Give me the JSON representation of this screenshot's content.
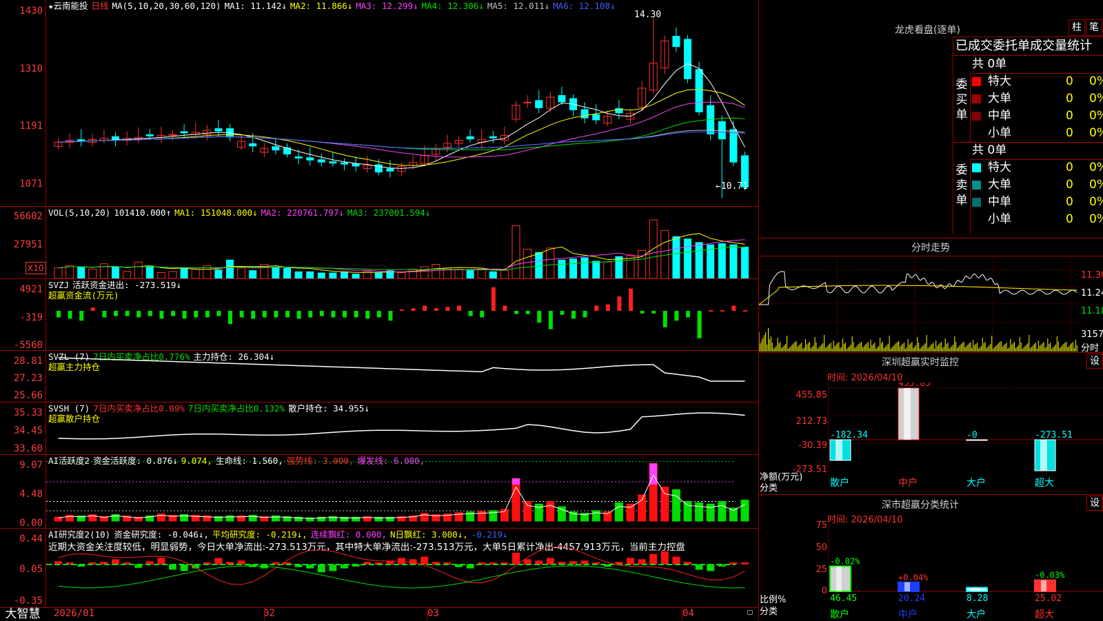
{
  "k": {
    "title": "★云南能投",
    "period": "日线",
    "ma_label": "MA(5,10,20,30,60,120)",
    "ma": [
      {
        "n": "MA1:",
        "v": "11.142↓",
        "c": "#ffffff"
      },
      {
        "n": "MA2:",
        "v": "11.866↓",
        "c": "#ffff00"
      },
      {
        "n": "MA3:",
        "v": "12.299↓",
        "c": "#ff40ff"
      },
      {
        "n": "MA4:",
        "v": "12.306↓",
        "c": "#00e000"
      },
      {
        "n": "MA5:",
        "v": "12.011↓",
        "c": "#c0c0c0"
      },
      {
        "n": "MA6:",
        "v": "12.108↓",
        "c": "#4060ff"
      }
    ],
    "y_ticks": [
      "1430",
      "1310",
      "1191",
      "1071"
    ],
    "high_note": "14.30",
    "low_note": "←10.71"
  },
  "vol": {
    "label": "VOL(5,10,20)",
    "value": "101410.000↑",
    "ma": [
      {
        "n": "MA1:",
        "v": "151048.000↓",
        "c": "#ffff00"
      },
      {
        "n": "MA2:",
        "v": "220761.797↓",
        "c": "#ff40ff"
      },
      {
        "n": "MA3:",
        "v": "237001.594↓",
        "c": "#00e000"
      }
    ],
    "y_ticks": [
      "56602",
      "27951"
    ],
    "unit": "X10"
  },
  "svzj": {
    "label": "SVZJ",
    "text": "活跃资金进出: -273.519↓",
    "sub": "超赢资金流(万元)",
    "y_ticks": [
      "4921",
      "-319",
      "-5560"
    ]
  },
  "svzl": {
    "label": "SVZL (7)",
    "t1": "7日内买卖净占比0.776%",
    "t2": "主力持仓: 26.304↓",
    "sub": "超赢主力持仓",
    "y_ticks": [
      "28.81",
      "27.23",
      "25.66"
    ]
  },
  "svsh": {
    "label": "SVSH (7)",
    "t1": "7日内买卖净占比0.09%",
    "t2": "7日内买卖净占比0.132%",
    "t3": "散户持仓: 34.955↓",
    "sub": "超赢散户持仓",
    "y_ticks": [
      "35.33",
      "34.45",
      "33.60"
    ]
  },
  "ai1": {
    "label": "AI活跃度2",
    "t1": "资金活跃度: 0.876↓",
    "t2": "9.074,",
    "t3": "生命线: 1.560,",
    "t4": "强势线: 3.000,",
    "t5": "爆发线: 6.000,",
    "y_ticks": [
      "9.07",
      "4.48",
      "0.00"
    ]
  },
  "ai2": {
    "label": "AI研究度2(10)",
    "t1": "资金研究度: -0.046↓,",
    "t2": "平均研究度: -0.219↓,",
    "t3": "连续飘红: 0.000,",
    "t4": "N日飘红: 3.000↓,",
    "t5": "-0.219↓",
    "comment": "近期大资金关注度较低，明显弱势，今日大单净流出:-273.513万元，其中特大单净流出:-273.513万元，大单5日累计净出-4457.913万元，当前主力控盘",
    "y_ticks": [
      "0.44",
      "0.05",
      "-0.35"
    ]
  },
  "x_ticks": [
    "2026/01",
    "02",
    "03",
    "04"
  ],
  "brand": "大智慧",
  "longhu": {
    "title": "龙虎看盘(逐单)",
    "btn1": "柱",
    "btn2": "笔",
    "tabs": "已成交委托单成交量统计",
    "buy_label": "委买单",
    "sell_label": "委卖单",
    "buy_total": "共 0单",
    "sell_total": "共 0单",
    "buy_rows": [
      {
        "name": "特大",
        "qty": "0",
        "pct": "0%",
        "color": "#ff0000"
      },
      {
        "name": "大单",
        "qty": "0",
        "pct": "0%",
        "color": "#a00000"
      },
      {
        "name": "中单",
        "qty": "0",
        "pct": "0%",
        "color": "#800000"
      },
      {
        "name": "小单",
        "qty": "0",
        "pct": "0%",
        "color": ""
      }
    ],
    "sell_rows": [
      {
        "name": "特大",
        "qty": "0",
        "pct": "0%",
        "color": "#00ffff"
      },
      {
        "name": "大单",
        "qty": "0",
        "pct": "0%",
        "color": "#009090"
      },
      {
        "name": "中单",
        "qty": "0",
        "pct": "0%",
        "color": "#007070"
      },
      {
        "name": "小单",
        "qty": "0",
        "pct": "0%",
        "color": ""
      }
    ]
  },
  "intraday": {
    "title": "分时走势",
    "y_ticks": [
      "11.30",
      "11.24",
      "11.18"
    ],
    "vol_tick": "3157",
    "vol_unit": "分时"
  },
  "monitor": {
    "title": "深圳超赢实时监控",
    "btn": "设",
    "time": "时间: 2026/04/10",
    "y_ticks": [
      "455.85",
      "212.73",
      "-30.39",
      "-273.51"
    ],
    "y_label": "净额(万元)",
    "x_label": "分类",
    "categories": [
      "散户",
      "中户",
      "大户",
      "超大"
    ],
    "values": [
      "-182.34",
      "455.85",
      "-0",
      "-273.51"
    ]
  },
  "stats": {
    "title": "深市超赢分类统计",
    "btn": "设",
    "time": "时间: 2026/04/10",
    "y_ticks": [
      "75",
      "50",
      "25",
      "0"
    ],
    "y_label": "比例%",
    "x_label": "分类",
    "categories": [
      "散户",
      "中户",
      "大户",
      "超大"
    ],
    "values": [
      "46.45",
      "20.24",
      "8.28",
      "25.02"
    ],
    "changes": [
      "-0.02%",
      "+0.04%",
      "",
      "-0.03%"
    ]
  },
  "chart_data": [
    {
      "type": "candlestick",
      "title": "云南能投 日线",
      "y_ticks": [
        "14.30",
        "13.10",
        "11.91",
        "10.71"
      ],
      "high": "14.30",
      "low": "10.71"
    },
    {
      "type": "bar",
      "title": "VOL(5,10,20)",
      "y_ticks": [
        56602,
        27951
      ],
      "unit": "X10"
    },
    {
      "type": "bar",
      "title": "超赢资金流(万元)",
      "y_ticks": [
        4921,
        -319,
        -5560
      ]
    },
    {
      "type": "line",
      "title": "超赢主力持仓",
      "y_ticks": [
        28.81,
        27.23,
        25.66
      ]
    },
    {
      "type": "line",
      "title": "超赢散户持仓",
      "y_ticks": [
        35.33,
        34.45,
        33.6
      ]
    },
    {
      "type": "bar",
      "title": "AI活跃度2",
      "y_ticks": [
        9.07,
        4.48,
        0.0
      ]
    },
    {
      "type": "bar",
      "title": "AI研究度2(10)",
      "y_ticks": [
        0.44,
        0.05,
        -0.35
      ]
    },
    {
      "type": "bar",
      "title": "深圳超赢实时监控",
      "categories": [
        "散户",
        "中户",
        "大户",
        "超大"
      ],
      "values": [
        -182.34,
        455.85,
        0,
        -273.51
      ],
      "ylabel": "净额(万元)",
      "xlabel": "分类"
    },
    {
      "type": "bar",
      "title": "深市超赢分类统计",
      "categories": [
        "散户",
        "中户",
        "大户",
        "超大"
      ],
      "values": [
        46.45,
        20.24,
        8.28,
        25.02
      ],
      "ylabel": "比例%",
      "xlabel": "分类",
      "ylim": [
        0,
        75
      ]
    }
  ]
}
